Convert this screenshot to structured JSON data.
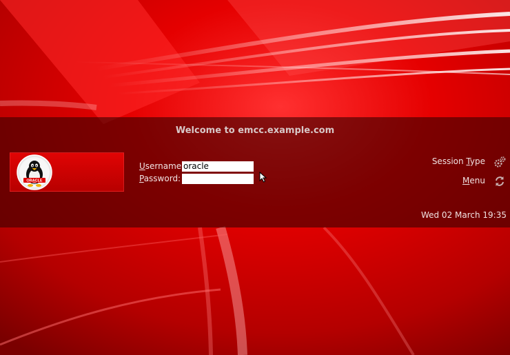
{
  "colors": {
    "background": "#d00000",
    "panel": "#3c0000",
    "tile": "#d00000",
    "text": "#f0e2e2"
  },
  "panel": {
    "welcome": "Welcome to emcc.example.com"
  },
  "user_tile": {
    "avatar_icon": "oracle-linux-penguin-icon",
    "logo_text": "ORACLE"
  },
  "login_form": {
    "username_mnemonic": "U",
    "username_label_rest": "sername:",
    "username_value": "oracle",
    "password_mnemonic": "P",
    "password_label_rest": "assword:",
    "password_value": ""
  },
  "session_type": {
    "label_pre": "Session ",
    "label_mnemonic": "T",
    "label_post": "ype",
    "icon": "gears-icon"
  },
  "menu": {
    "label_mnemonic": "M",
    "label_rest": "enu",
    "icon": "power-cycle-icon"
  },
  "clock": "Wed 02 March 19:35"
}
